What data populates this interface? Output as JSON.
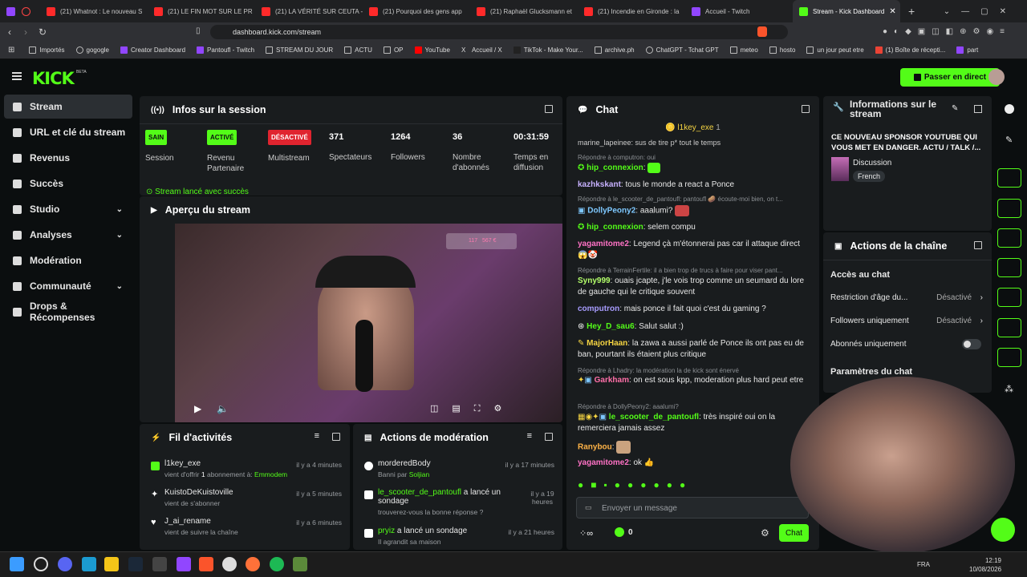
{
  "browser": {
    "tabs": [
      "(21) Whatnot : Le nouveau S",
      "(21) LE FIN MOT SUR LE PR",
      "(21) LA VÉRITÉ SUR CEUTA -",
      "(21) Pourquoi des gens app",
      "(21) Raphaël Glucksmann et",
      "(21) Incendie en Gironde : la",
      "Accueil - Twitch",
      "Stream - Kick Dashboard"
    ],
    "url": "dashboard.kick.com/stream",
    "bookmarks": [
      "Importés",
      "gogogle",
      "Creator Dashboard",
      "Pantoufl - Twitch",
      "STREAM DU JOUR",
      "ACTU",
      "OP",
      "YouTube",
      "Accueil / X",
      "TikTok - Make Your...",
      "archive.ph",
      "ChatGPT - Tchat GPT",
      "meteo",
      "hosto",
      "un jour peut etre",
      "(1) Boîte de récepti...",
      "part"
    ]
  },
  "header": {
    "logo": "KICK",
    "beta": "BETA",
    "go_live": "Passer en direct"
  },
  "sidebar": [
    {
      "label": "Stream",
      "icon": "broadcast-icon",
      "selected": true
    },
    {
      "label": "URL et clé du stream",
      "icon": "link-icon"
    },
    {
      "label": "Revenus",
      "icon": "chart-icon"
    },
    {
      "label": "Succès",
      "icon": "trophy-icon"
    },
    {
      "label": "Studio",
      "icon": "studio-icon",
      "chevron": true
    },
    {
      "label": "Analyses",
      "icon": "analytics-icon",
      "chevron": true
    },
    {
      "label": "Modération",
      "icon": "wrench-icon"
    },
    {
      "label": "Communauté",
      "icon": "community-icon",
      "chevron": true
    },
    {
      "label": "Drops & Récompenses",
      "icon": "gift-icon"
    }
  ],
  "session": {
    "title": "Infos sur la session",
    "stats": [
      {
        "badge": "SAIN",
        "badge_color": "#53fc18",
        "label": "Session"
      },
      {
        "badge": "ACTIVÉ",
        "badge_color": "#53fc18",
        "label": "Revenu Partenaire"
      },
      {
        "badge": "DÉSACTIVÉ",
        "badge_color": "#e0242f",
        "label": "Multistream"
      },
      {
        "value": "371",
        "label": "Spectateurs"
      },
      {
        "value": "1264",
        "label": "Followers"
      },
      {
        "value": "36",
        "label": "Nombre d'abonnés"
      },
      {
        "value": "00:31:59",
        "label": "Temps en diffusion"
      }
    ],
    "status": "Stream lancé avec succès"
  },
  "preview": {
    "title": "Aperçu du stream",
    "overlay_count": "117",
    "overlay_money": "567 €"
  },
  "activity": {
    "title": "Fil d'activités",
    "items": [
      {
        "user": "l1key_exe",
        "time": "il y a 4 minutes",
        "sub_a": "vient d'offrir ",
        "sub_b": "1",
        "sub_c": " abonnement à: ",
        "sub_d": "Emmodem",
        "color": "#53fc18"
      },
      {
        "user": "KuistoDeKuistoville",
        "time": "il y a 5 minutes",
        "sub_a": "vient de s'abonner",
        "color": "#ffffff"
      },
      {
        "user": "J_ai_rename",
        "time": "il y a 6 minutes",
        "sub_a": "vient de suivre la chaîne",
        "color": "#ffffff"
      }
    ]
  },
  "moderation": {
    "title": "Actions de modération",
    "items": [
      {
        "user": "morderedBody",
        "time": "il y a 17 minutes",
        "sub": "Banni par ",
        "sub_user": "Soljian"
      },
      {
        "user": "le_scooter_de_pantoufl",
        "action": " a lancé un sondage",
        "time": "il y a 19 heures",
        "sub": "trouverez-vous la bonne réponse ?"
      },
      {
        "user": "pryiz",
        "action": " a lancé un sondage",
        "time": "il y a 21 heures",
        "sub": "Il agrandit sa maison"
      }
    ]
  },
  "chat": {
    "title": "Chat",
    "pinned_user": "l1key_exe",
    "pinned_count": "1",
    "partial_line": "marine_lapeinee: sus de tire p* tout le temps",
    "messages": [
      {
        "reply": "Répondre à computron: oui"
      },
      {
        "user": "hip_connexion",
        "color": "#53fc18",
        "text": ":"
      },
      {
        "user": "kazhkskant",
        "color": "#c7b1ff",
        "text": ": tous le monde a react a Ponce"
      },
      {
        "reply": "Répondre à le_scooter_de_pantoufl: pantoufl 🥔 écoute-moi bien, on t..."
      },
      {
        "user": "DollyPeony2",
        "color": "#7ec8ff",
        "text": ": aaalumi?"
      },
      {
        "user": "hip_connexion",
        "color": "#53fc18",
        "text": ": selem compu"
      },
      {
        "user": "yagamitome2",
        "color": "#ff72c6",
        "text": ": Legend çà m'étonnerai pas car il attaque direct"
      },
      {
        "reply": "Répondre à TerrainFertile: il a bien trop de trucs à faire pour viser pant..."
      },
      {
        "user": "Syny999",
        "color": "#b4ff6b",
        "text": ": ouais jcapte, j'le vois trop comme un seumard du lore de gauche qui le critique souvent"
      },
      {
        "user": "computron",
        "color": "#a89cff",
        "text": ": mais ponce il fait quoi c'est du gaming ?"
      },
      {
        "user": "Hey_D_sau6",
        "color": "#53fc18",
        "text": ": Salut salut :)"
      },
      {
        "user": "MajorHaan",
        "color": "#f5d442",
        "text": ": la zawa a aussi parlé de Ponce ils ont pas eu de ban, pourtant ils étaient plus critique"
      },
      {
        "reply": "Répondre à Lhadry: la modération la de kick sont énervé"
      },
      {
        "user": "Garkham",
        "color": "#ff6fa8",
        "text": ": on est sous kpp, moderation plus hard peut etre"
      },
      {
        "reply": "Répondre à DollyPeony2: aaalumi?"
      },
      {
        "user": "le_scooter_de_pantoufl",
        "color": "#53fc18",
        "text": ": très inspiré oui on la remerciera jamais assez"
      },
      {
        "user": "Ranybou",
        "color": "#ffb347",
        "text": ":"
      },
      {
        "user": "yagamitome2",
        "color": "#ff72c6",
        "text": ": ok 👍"
      }
    ],
    "placeholder": "Envoyer un message",
    "points": "0",
    "send": "Chat"
  },
  "info": {
    "title": "Informations sur le stream",
    "stream_title": "CE NOUVEAU SPONSOR YOUTUBE QUI VOUS MET EN DANGER. ACTU / TALK /...",
    "category": "Discussion",
    "language": "French"
  },
  "channel": {
    "title": "Actions de la chaîne",
    "section": "Accès au chat",
    "rows": [
      {
        "label": "Restriction d'âge du...",
        "value": "Désactivé"
      },
      {
        "label": "Followers uniquement",
        "value": "Désactivé"
      },
      {
        "label": "Abonnés uniquement",
        "value": ""
      }
    ],
    "section2": "Paramètres du chat"
  },
  "taskbar": {
    "lang": "FRA",
    "time": "12:19",
    "date": "10/08/2026"
  }
}
